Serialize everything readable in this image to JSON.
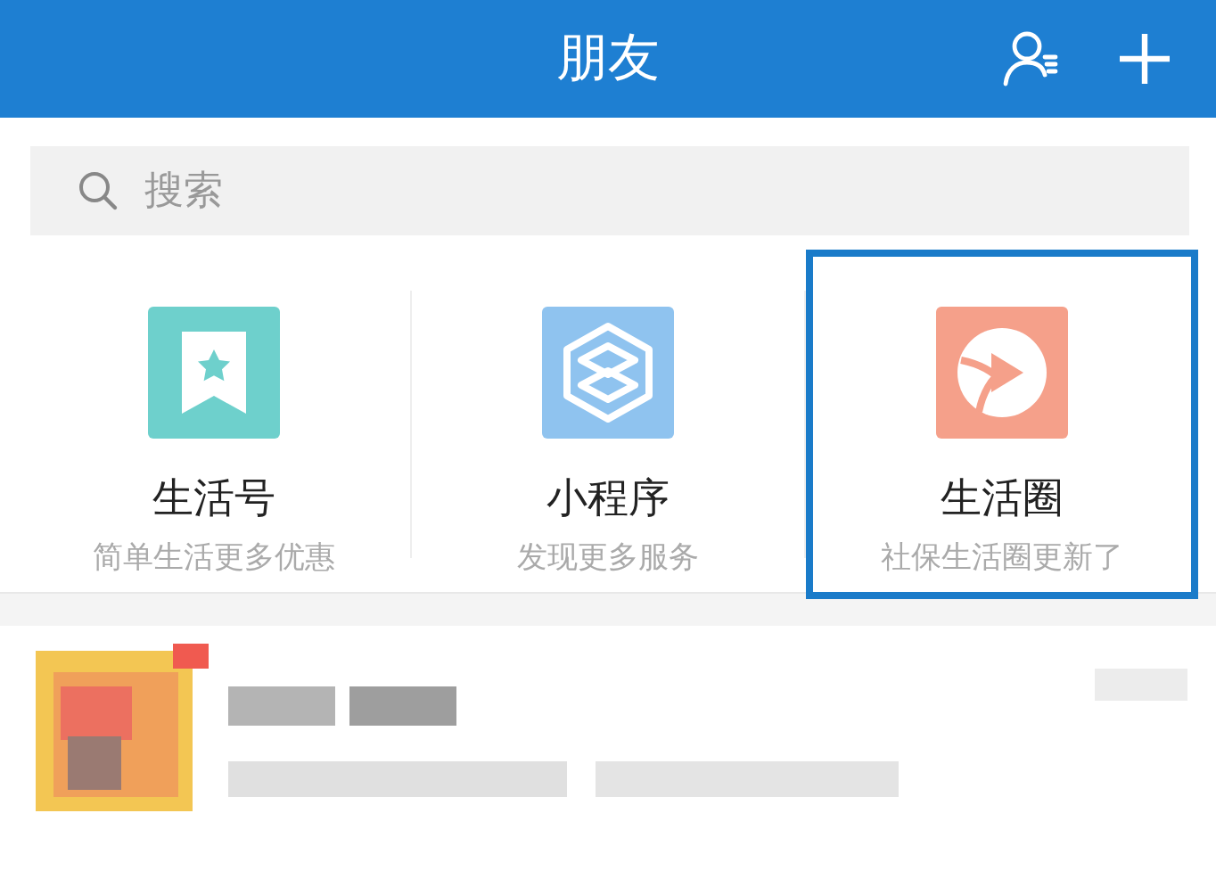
{
  "header": {
    "title": "朋友"
  },
  "search": {
    "placeholder": "搜索"
  },
  "entries": [
    {
      "kind": "bookmark",
      "title": "生活号",
      "subtitle": "简单生活更多优惠",
      "selected": false
    },
    {
      "kind": "hexagon",
      "title": "小程序",
      "subtitle": "发现更多服务",
      "selected": false
    },
    {
      "kind": "play",
      "title": "生活圈",
      "subtitle": "社保生活圈更新了",
      "selected": true
    }
  ]
}
